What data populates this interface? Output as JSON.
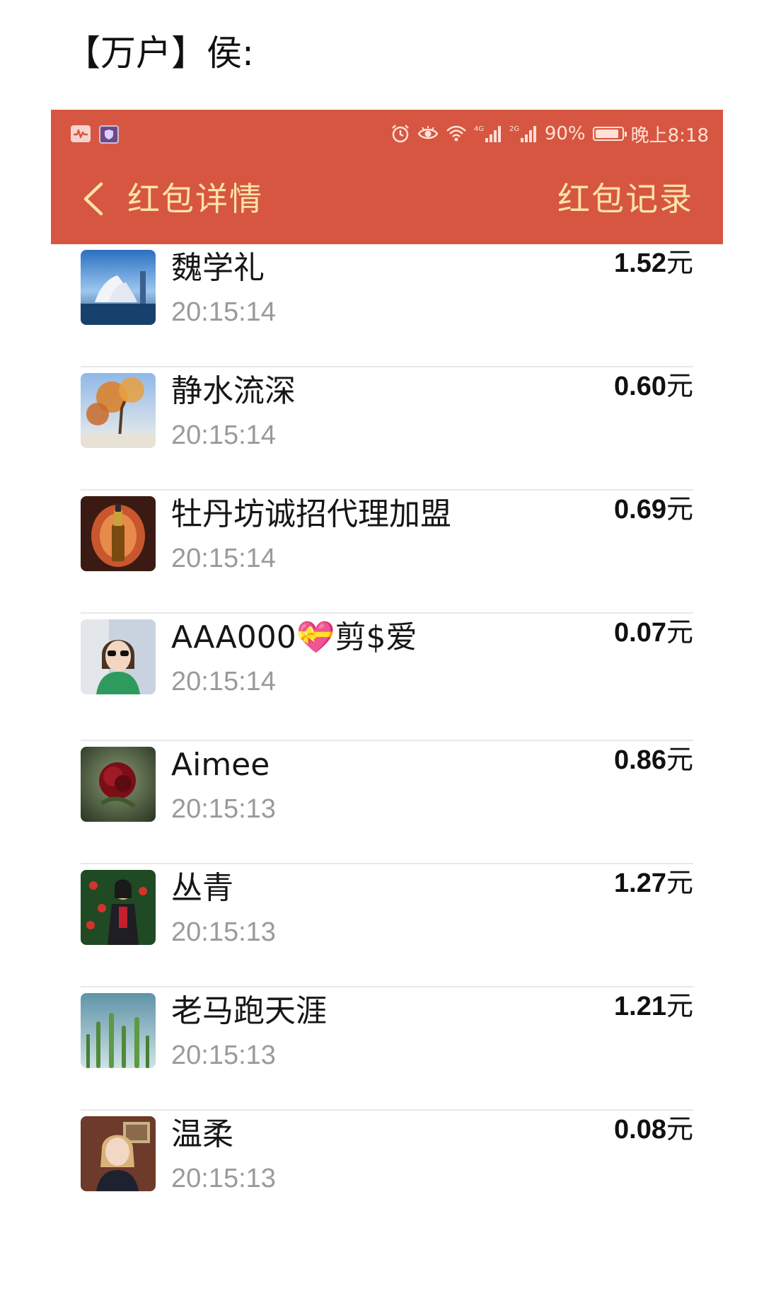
{
  "caption": "【万户】侯:",
  "status_bar": {
    "left_icons": [
      "activity-icon",
      "shield-icon"
    ],
    "right_icons": [
      "alarm-icon",
      "eye-icon",
      "wifi-icon",
      "signal-4g-icon",
      "signal-2g-icon"
    ],
    "net1": "4G",
    "net2": "2G",
    "battery_percent_text": "90%",
    "battery_level": 0.9,
    "time": "晚上8:18"
  },
  "navbar": {
    "back_icon": "chevron-left-icon",
    "title": "红包详情",
    "action": "红包记录"
  },
  "colors": {
    "header_bg": "#d75641",
    "header_text": "#fbe3a6",
    "time_text": "#9a9a9a",
    "divider": "#e8e8e8"
  },
  "unit": "元",
  "records": [
    {
      "name": "魏学礼",
      "time": "20:15:14",
      "amount": "1.52",
      "avatar": "avatar-landmark"
    },
    {
      "name": "静水流深",
      "time": "20:15:14",
      "amount": "0.60",
      "avatar": "avatar-autumn-tree"
    },
    {
      "name": "牡丹坊诚招代理加盟",
      "time": "20:15:14",
      "amount": "0.69",
      "avatar": "avatar-serum-bottle"
    },
    {
      "name": "AAA000💝剪$爱",
      "time": "20:15:14",
      "amount": "0.07",
      "avatar": "avatar-woman-sunglasses"
    },
    {
      "name": "Aimee",
      "time": "20:15:13",
      "amount": "0.86",
      "avatar": "avatar-red-rose"
    },
    {
      "name": "丛青",
      "time": "20:15:13",
      "amount": "1.27",
      "avatar": "avatar-woman-garden"
    },
    {
      "name": "老马跑天涯",
      "time": "20:15:13",
      "amount": "1.21",
      "avatar": "avatar-cactus"
    },
    {
      "name": "温柔",
      "time": "20:15:13",
      "amount": "0.08",
      "avatar": "avatar-woman-indoor"
    }
  ]
}
